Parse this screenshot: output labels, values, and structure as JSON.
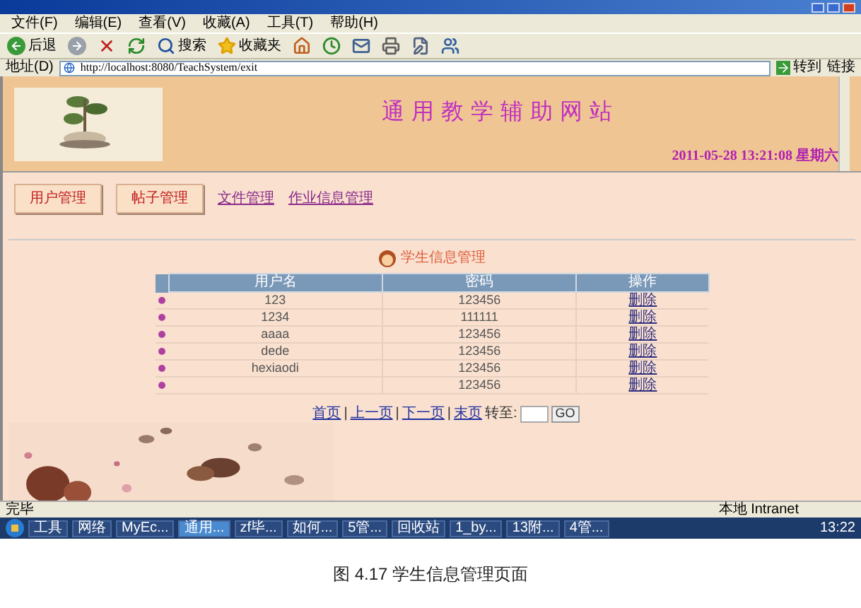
{
  "menu": [
    "文件(F)",
    "编辑(E)",
    "查看(V)",
    "收藏(A)",
    "工具(T)",
    "帮助(H)"
  ],
  "toolbar": [
    {
      "kind": "back",
      "label": "后退"
    },
    {
      "kind": "forward"
    },
    {
      "kind": "stop"
    },
    {
      "kind": "refresh"
    },
    {
      "kind": "search",
      "label": "搜索"
    },
    {
      "kind": "favorites",
      "label": "收藏夹"
    },
    {
      "kind": "home"
    },
    {
      "kind": "history"
    },
    {
      "kind": "mail"
    },
    {
      "kind": "print"
    },
    {
      "kind": "edit"
    },
    {
      "kind": "messenger"
    }
  ],
  "address": {
    "label": "地址(D)",
    "value": "http://localhost:8080/TeachSystem/exit",
    "go": "转到",
    "links": "链接"
  },
  "site": {
    "title": "通用教学辅助网站",
    "datetime": "2011-05-28 13:21:08 星期六"
  },
  "nav": [
    {
      "kind": "button",
      "label": "用户管理"
    },
    {
      "kind": "button",
      "label": "帖子管理"
    },
    {
      "kind": "link",
      "label": "文件管理"
    },
    {
      "kind": "link",
      "label": "作业信息管理"
    }
  ],
  "section_title": "学生信息管理",
  "table": {
    "columns": [
      "用户名",
      "密码",
      "操作"
    ],
    "rows": [
      {
        "name": "123",
        "password": "123456",
        "action": "删除"
      },
      {
        "name": "1234",
        "password": "111111",
        "action": "删除"
      },
      {
        "name": "aaaa",
        "password": "123456",
        "action": "删除"
      },
      {
        "name": "dede",
        "password": "123456",
        "action": "删除"
      },
      {
        "name": "hexiaodi",
        "password": "123456",
        "action": "删除"
      },
      {
        "password": "123456",
        "action": "删除"
      }
    ]
  },
  "pagination": {
    "links": [
      "首页",
      "上一页",
      "下一页",
      "末页"
    ],
    "separator": "|",
    "goto_label": "转至:",
    "go": "GO"
  },
  "status_bar": {
    "text": "完毕",
    "zone": "本地 Intranet"
  },
  "taskbar": {
    "items": [
      {
        "label": "工具",
        "selected": false
      },
      {
        "label": "网络",
        "selected": false
      },
      {
        "label": "MyEc...",
        "selected": false
      },
      {
        "label": "通用...",
        "selected": true
      },
      {
        "label": "zf毕...",
        "selected": false
      },
      {
        "label": "如何...",
        "selected": false
      },
      {
        "label": "5管...",
        "selected": false
      },
      {
        "label": "回收站",
        "selected": false
      },
      {
        "label": "1_by...",
        "selected": false
      },
      {
        "label": "13附...",
        "selected": false
      },
      {
        "label": "4管...",
        "selected": false
      }
    ],
    "clock": "13:22"
  },
  "caption": "图 4.17  学生信息管理页面"
}
